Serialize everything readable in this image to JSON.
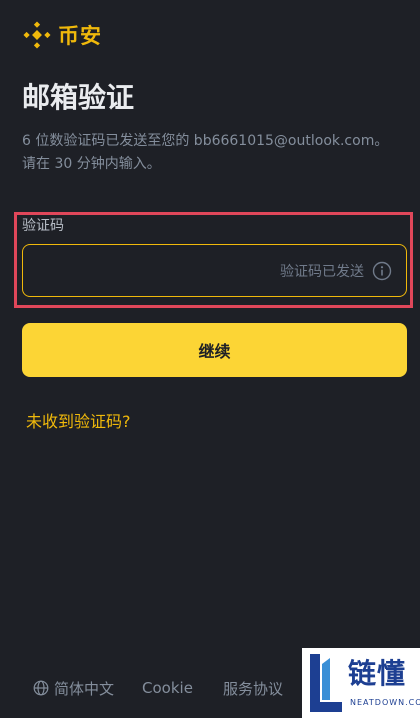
{
  "brand": {
    "name": "币安",
    "accent_color": "#f0b90b",
    "logo_icon": "binance-logo-icon"
  },
  "page": {
    "title": "邮箱验证",
    "description_line1": "6 位数验证码已发送至您的 bb6661015@outlook.com。",
    "description_line2": "请在 30 分钟内输入。"
  },
  "form": {
    "code_label": "验证码",
    "code_value": "",
    "code_sent_status": "验证码已发送",
    "info_icon": "info-circle-icon"
  },
  "actions": {
    "continue_label": "继续",
    "continue_color": "#fcd535",
    "resend_link": "未收到验证码?"
  },
  "footer": {
    "language_icon": "globe-icon",
    "language": "简体中文",
    "cookie": "Cookie",
    "terms": "服务协议"
  },
  "watermark": {
    "text": "链懂",
    "url": "NEATDOWN.COM"
  }
}
